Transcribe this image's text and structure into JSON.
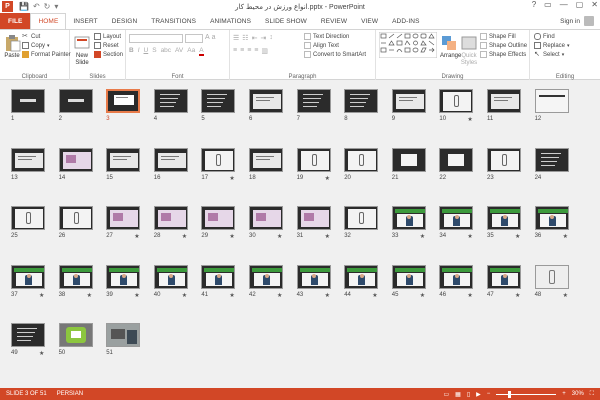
{
  "titlebar": {
    "app_letter": "P",
    "title": "انواع ورزش در محیط کار.pptx - PowerPoint",
    "qat": [
      "💾",
      "↶",
      "↻",
      "▾"
    ],
    "win": [
      "?",
      "▭",
      "—",
      "▢",
      "✕"
    ]
  },
  "tabs": [
    {
      "label": "FILE",
      "kind": "file"
    },
    {
      "label": "HOME",
      "kind": "active"
    },
    {
      "label": "INSERT"
    },
    {
      "label": "DESIGN"
    },
    {
      "label": "TRANSITIONS"
    },
    {
      "label": "ANIMATIONS"
    },
    {
      "label": "SLIDE SHOW"
    },
    {
      "label": "REVIEW"
    },
    {
      "label": "VIEW"
    },
    {
      "label": "ADD-INS"
    }
  ],
  "signin": "Sign in",
  "ribbon": {
    "clipboard": {
      "label": "Clipboard",
      "paste": "Paste",
      "cut": "Cut",
      "copy": "Copy",
      "format_painter": "Format Painter"
    },
    "slides": {
      "label": "Slides",
      "new_slide": "New",
      "new_slide2": "Slide",
      "layout": "Layout",
      "reset": "Reset",
      "section": "Section"
    },
    "font": {
      "label": "Font"
    },
    "paragraph": {
      "label": "Paragraph",
      "text_direction": "Text Direction",
      "align_text": "Align Text",
      "convert": "Convert to SmartArt"
    },
    "drawing": {
      "label": "Drawing",
      "arrange": "Arrange",
      "quick_styles": "Quick",
      "quick_styles2": "Styles",
      "shape_fill": "Shape Fill",
      "shape_outline": "Shape Outline",
      "shape_effects": "Shape Effects"
    },
    "editing": {
      "label": "Editing",
      "find": "Find",
      "replace": "Replace",
      "select": "Select"
    }
  },
  "slides": [
    {
      "n": "1",
      "star": false,
      "kind": "dark-title"
    },
    {
      "n": "2",
      "star": false,
      "kind": "dark-title"
    },
    {
      "n": "3",
      "star": false,
      "kind": "white-box",
      "selected": true
    },
    {
      "n": "4",
      "star": false,
      "kind": "dark-text"
    },
    {
      "n": "5",
      "star": false,
      "kind": "dark-text"
    },
    {
      "n": "6",
      "star": false,
      "kind": "dark-light"
    },
    {
      "n": "7",
      "star": false,
      "kind": "dark-text"
    },
    {
      "n": "8",
      "star": false,
      "kind": "dark-text"
    },
    {
      "n": "9",
      "star": false,
      "kind": "dark-light"
    },
    {
      "n": "10",
      "star": true,
      "kind": "figure"
    },
    {
      "n": "11",
      "star": false,
      "kind": "dark-light"
    },
    {
      "n": "12",
      "star": false,
      "kind": "white-line"
    },
    {
      "n": "13",
      "star": false,
      "kind": "dark-light"
    },
    {
      "n": "14",
      "star": false,
      "kind": "pink"
    },
    {
      "n": "15",
      "star": false,
      "kind": "dark-light"
    },
    {
      "n": "16",
      "star": false,
      "kind": "dark-light"
    },
    {
      "n": "17",
      "star": true,
      "kind": "figure"
    },
    {
      "n": "18",
      "star": false,
      "kind": "dark-light"
    },
    {
      "n": "19",
      "star": true,
      "kind": "figure"
    },
    {
      "n": "20",
      "star": false,
      "kind": "figure"
    },
    {
      "n": "21",
      "star": false,
      "kind": "dark-box"
    },
    {
      "n": "22",
      "star": false,
      "kind": "dark-box"
    },
    {
      "n": "23",
      "star": false,
      "kind": "figure"
    },
    {
      "n": "24",
      "star": false,
      "kind": "dark-text"
    },
    {
      "n": "25",
      "star": false,
      "kind": "figure"
    },
    {
      "n": "26",
      "star": false,
      "kind": "figure"
    },
    {
      "n": "27",
      "star": true,
      "kind": "pink"
    },
    {
      "n": "28",
      "star": true,
      "kind": "pink"
    },
    {
      "n": "29",
      "star": true,
      "kind": "pink"
    },
    {
      "n": "30",
      "star": true,
      "kind": "pink"
    },
    {
      "n": "31",
      "star": true,
      "kind": "pink"
    },
    {
      "n": "32",
      "star": false,
      "kind": "figure"
    },
    {
      "n": "33",
      "star": true,
      "kind": "photo"
    },
    {
      "n": "34",
      "star": true,
      "kind": "photo"
    },
    {
      "n": "35",
      "star": true,
      "kind": "photo"
    },
    {
      "n": "36",
      "star": true,
      "kind": "photo"
    },
    {
      "n": "37",
      "star": true,
      "kind": "photo"
    },
    {
      "n": "38",
      "star": true,
      "kind": "photo"
    },
    {
      "n": "39",
      "star": true,
      "kind": "photo"
    },
    {
      "n": "40",
      "star": true,
      "kind": "photo"
    },
    {
      "n": "41",
      "star": true,
      "kind": "photo"
    },
    {
      "n": "42",
      "star": true,
      "kind": "photo"
    },
    {
      "n": "43",
      "star": true,
      "kind": "photo"
    },
    {
      "n": "44",
      "star": true,
      "kind": "photo"
    },
    {
      "n": "45",
      "star": true,
      "kind": "photo"
    },
    {
      "n": "46",
      "star": true,
      "kind": "photo"
    },
    {
      "n": "47",
      "star": true,
      "kind": "photo"
    },
    {
      "n": "48",
      "star": true,
      "kind": "figure-light"
    },
    {
      "n": "49",
      "star": true,
      "kind": "dark-text"
    },
    {
      "n": "50",
      "star": false,
      "kind": "cartoon"
    },
    {
      "n": "51",
      "star": false,
      "kind": "office-photo"
    }
  ],
  "status": {
    "slide_info": "SLIDE 3 OF 51",
    "language": "PERSIAN",
    "zoom": "30%"
  },
  "colors": {
    "accent": "#d24726",
    "selected": "#e87b4a"
  }
}
